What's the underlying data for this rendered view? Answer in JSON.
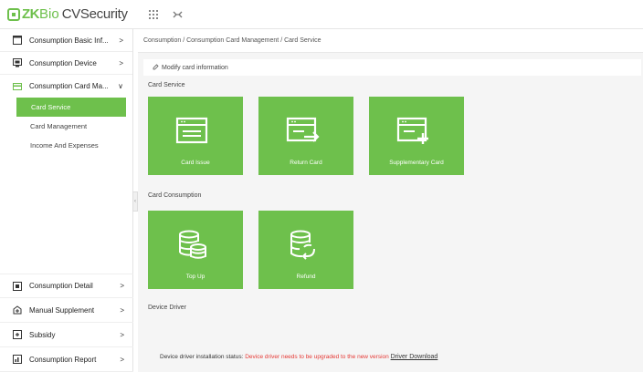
{
  "app": {
    "logo_zk": "ZK",
    "logo_bio": "Bio",
    "logo_cv": "CVSecurity"
  },
  "sidebar": {
    "items": [
      {
        "label": "Consumption Basic Inf...",
        "arrow": ">"
      },
      {
        "label": "Consumption Device",
        "arrow": ">"
      },
      {
        "label": "Consumption Card Ma...",
        "arrow": "∨"
      }
    ],
    "sub_items": [
      {
        "label": "Card Service"
      },
      {
        "label": "Card Management"
      },
      {
        "label": "Income And Expenses"
      }
    ],
    "lower_items": [
      {
        "label": "Consumption Detail",
        "arrow": ">"
      },
      {
        "label": "Manual Supplement",
        "arrow": ">"
      },
      {
        "label": "Subsidy",
        "arrow": ">"
      },
      {
        "label": "Consumption Report",
        "arrow": ">"
      }
    ]
  },
  "breadcrumb": "Consumption / Consumption Card Management / Card Service",
  "modify_bar": "Modify card information",
  "sections": {
    "card_service": "Card Service",
    "card_consumption": "Card Consumption",
    "device_driver": "Device Driver"
  },
  "tiles": {
    "card_issue": "Card Issue",
    "return_card": "Return Card",
    "supplementary_card": "Supplementary Card",
    "top_up": "Top Up",
    "refund": "Refund"
  },
  "driver": {
    "status_label": "Device driver installation status:",
    "status_warning": "Device driver needs to be upgraded to the new version",
    "download_link": "Driver Download"
  },
  "colors": {
    "accent": "#6ec04c",
    "warning": "#e53935"
  }
}
